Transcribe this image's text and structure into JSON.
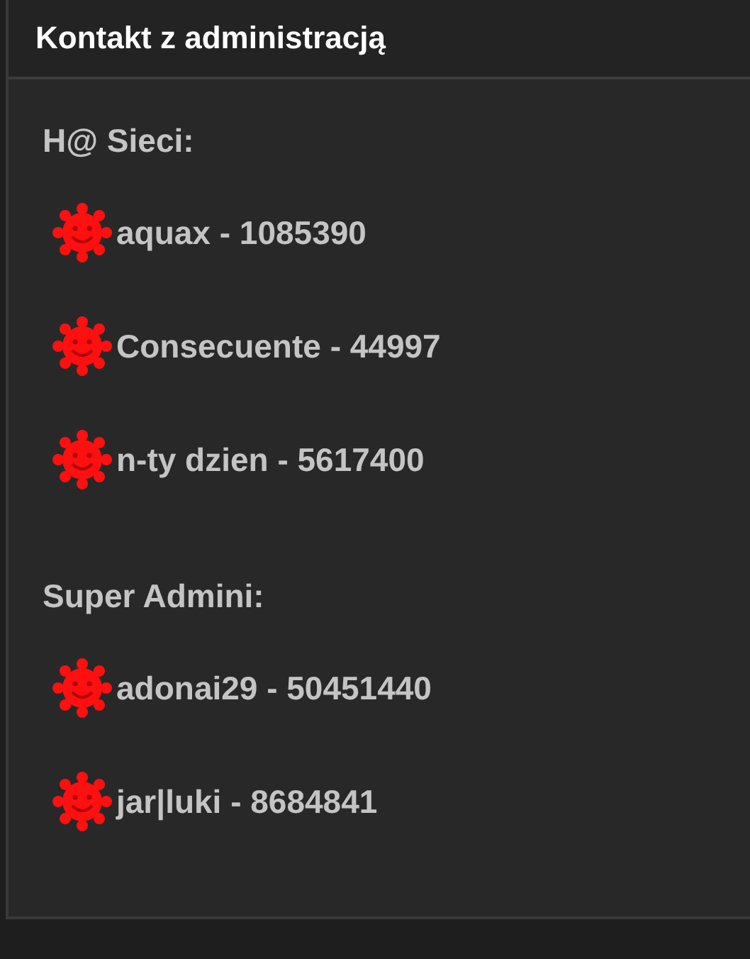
{
  "panel": {
    "title": "Kontakt z administracją"
  },
  "groups": [
    {
      "heading": "H@ Sieci:",
      "members": [
        {
          "text": "aquax - 1085390"
        },
        {
          "text": "Consecuente - 44997"
        },
        {
          "text": "n-ty dzien - 5617400"
        }
      ]
    },
    {
      "heading": "Super Admini:",
      "members": [
        {
          "text": "adonai29 - 50451440"
        },
        {
          "text": "jar|luki - 8684841"
        }
      ]
    }
  ]
}
